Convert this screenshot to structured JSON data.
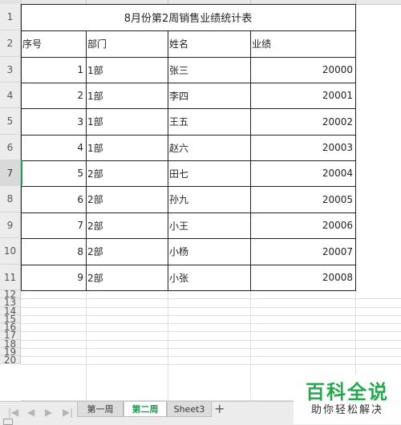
{
  "spreadsheet": {
    "title": "8月份第2周销售业绩统计表",
    "headers": [
      "序号",
      "部门",
      "姓名",
      "业绩"
    ],
    "rows": [
      [
        "1",
        "1部",
        "张三",
        "20000"
      ],
      [
        "2",
        "1部",
        "李四",
        "20001"
      ],
      [
        "3",
        "1部",
        "王五",
        "20002"
      ],
      [
        "4",
        "1部",
        "赵六",
        "20003"
      ],
      [
        "5",
        "2部",
        "田七",
        "20004"
      ],
      [
        "6",
        "2部",
        "孙九",
        "20005"
      ],
      [
        "7",
        "2部",
        "小王",
        "20006"
      ],
      [
        "8",
        "2部",
        "小杨",
        "20007"
      ],
      [
        "9",
        "2部",
        "小张",
        "20008"
      ]
    ],
    "row_numbers": [
      "1",
      "2",
      "3",
      "4",
      "5",
      "6",
      "7",
      "8",
      "9",
      "10",
      "11",
      "12",
      "13",
      "14",
      "15",
      "16",
      "17",
      "18",
      "19",
      "20"
    ],
    "active_row": "7"
  },
  "sheet_tabs": {
    "tabs": [
      "第一周",
      "第二周",
      "Sheet3"
    ],
    "active": "第二周",
    "add_label": "+"
  },
  "watermark": {
    "title": "百科全说",
    "subtitle": "助你轻松解决"
  },
  "colors": {
    "accent": "#1e9a52",
    "watermark": "#22a94b"
  }
}
